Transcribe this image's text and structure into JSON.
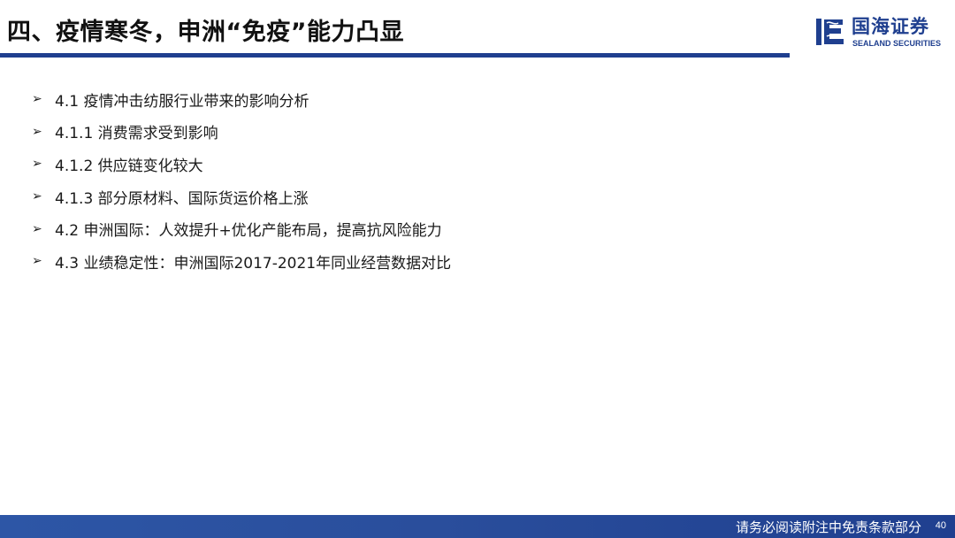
{
  "header": {
    "title": "四、疫情寒冬，申洲“免疫”能力凸显",
    "rule_color": "#1f3f8f"
  },
  "logo": {
    "name_cn": "国海证券",
    "name_en": "SEALAND SECURITIES",
    "icon": "sealand-logo-icon",
    "color": "#1f3f8f"
  },
  "toc": {
    "bullet_icon": "arrow-bullet-icon",
    "items": [
      {
        "label": "4.1 疫情冲击纺服行业带来的影响分析"
      },
      {
        "label": "4.1.1 消费需求受到影响"
      },
      {
        "label": "4.1.2 供应链变化较大"
      },
      {
        "label": "4.1.3 部分原材料、国际货运价格上涨"
      },
      {
        "label": "4.2 申洲国际：人效提升+优化产能布局，提高抗风险能力"
      },
      {
        "label": "4.3 业绩稳定性：申洲国际2017-2021年同业经营数据对比"
      }
    ]
  },
  "footer": {
    "disclaimer": "请务必阅读附注中免责条款部分",
    "page_number": "40",
    "bar_color": "#2a4e9c"
  }
}
